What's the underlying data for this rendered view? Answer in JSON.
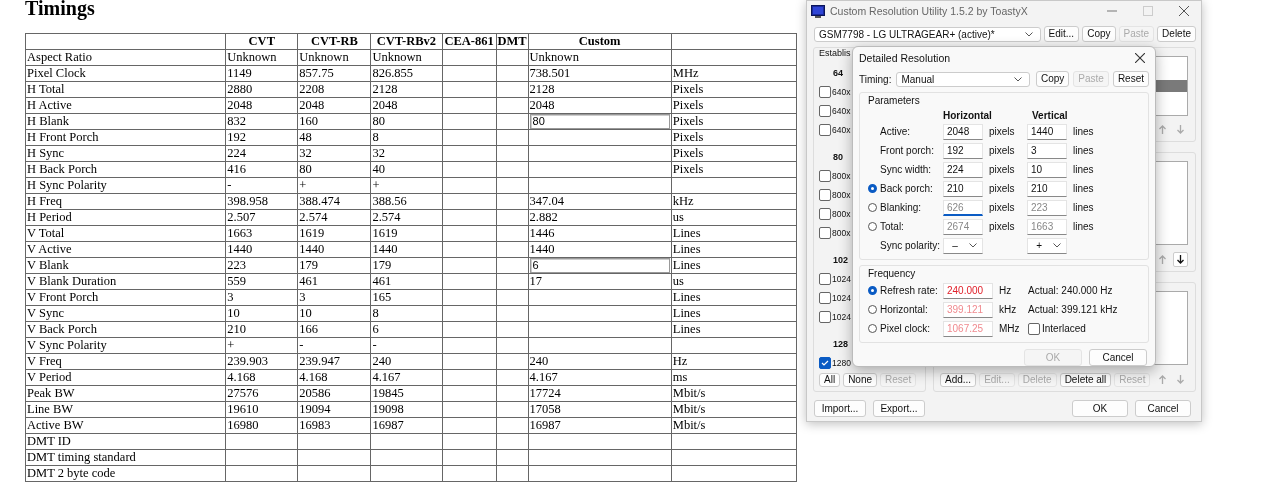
{
  "page": {
    "heading": "Timings",
    "table": {
      "columns": [
        "CVT",
        "CVT-RB",
        "CVT-RBv2",
        "CEA-861",
        "DMT",
        "Custom"
      ],
      "rows": [
        {
          "label": "Aspect Ratio",
          "cells": [
            "Unknown",
            "Unknown",
            "Unknown",
            null,
            null
          ],
          "custom": "Unknown",
          "custom_editable": false
        },
        {
          "label": "Pixel Clock",
          "cells": [
            "1149",
            "857.75",
            "826.855",
            null,
            null
          ],
          "custom": "738.501",
          "custom_editable": false,
          "unit": "MHz"
        },
        {
          "label": "H Total",
          "cells": [
            "2880",
            "2208",
            "2128",
            null,
            null
          ],
          "custom": "2128",
          "custom_editable": false,
          "unit": "Pixels"
        },
        {
          "label": "H Active",
          "cells": [
            "2048",
            "2048",
            "2048",
            null,
            null
          ],
          "custom": "2048",
          "custom_editable": false,
          "unit": "Pixels"
        },
        {
          "label": "H Blank",
          "cells": [
            "832",
            "160",
            "80",
            null,
            null
          ],
          "custom": "80",
          "custom_editable": true,
          "unit": "Pixels"
        },
        {
          "label": "H Front Porch",
          "cells": [
            "192",
            "48",
            "8",
            null,
            null
          ],
          "custom_editable": false,
          "unit": "Pixels"
        },
        {
          "label": "H Sync",
          "cells": [
            "224",
            "32",
            "32",
            null,
            null
          ],
          "custom_editable": false,
          "unit": "Pixels"
        },
        {
          "label": "H Back Porch",
          "cells": [
            "416",
            "80",
            "40",
            null,
            null
          ],
          "custom_editable": false,
          "unit": "Pixels"
        },
        {
          "label": "H Sync Polarity",
          "cells": [
            "-",
            "+",
            "+",
            null,
            null
          ],
          "custom_editable": false
        },
        {
          "label": "H Freq",
          "cells": [
            "398.958",
            "388.474",
            "388.56",
            null,
            null
          ],
          "custom": "347.04",
          "custom_editable": false,
          "unit": "kHz"
        },
        {
          "label": "H Period",
          "cells": [
            "2.507",
            "2.574",
            "2.574",
            null,
            null
          ],
          "custom": "2.882",
          "custom_editable": false,
          "unit": "us"
        },
        {
          "label": "V Total",
          "cells": [
            "1663",
            "1619",
            "1619",
            null,
            null
          ],
          "custom": "1446",
          "custom_editable": false,
          "unit": "Lines"
        },
        {
          "label": "V Active",
          "cells": [
            "1440",
            "1440",
            "1440",
            null,
            null
          ],
          "custom": "1440",
          "custom_editable": false,
          "unit": "Lines"
        },
        {
          "label": "V Blank",
          "cells": [
            "223",
            "179",
            "179",
            null,
            null
          ],
          "custom": "6",
          "custom_editable": true,
          "unit": "Lines"
        },
        {
          "label": "V Blank Duration",
          "cells": [
            "559",
            "461",
            "461",
            null,
            null
          ],
          "custom": "17",
          "custom_editable": false,
          "unit": "us"
        },
        {
          "label": "V Front Porch",
          "cells": [
            "3",
            "3",
            "165",
            null,
            null
          ],
          "custom_editable": false,
          "unit": "Lines"
        },
        {
          "label": "V Sync",
          "cells": [
            "10",
            "10",
            "8",
            null,
            null
          ],
          "custom_editable": false,
          "unit": "Lines"
        },
        {
          "label": "V Back Porch",
          "cells": [
            "210",
            "166",
            "6",
            null,
            null
          ],
          "custom_editable": false,
          "unit": "Lines"
        },
        {
          "label": "V Sync Polarity",
          "cells": [
            "+",
            "-",
            "-",
            null,
            null
          ],
          "custom_editable": false
        },
        {
          "label": "V Freq",
          "cells": [
            "239.903",
            "239.947",
            "240",
            null,
            null
          ],
          "custom": "240",
          "custom_editable": false,
          "unit": "Hz"
        },
        {
          "label": "V Period",
          "cells": [
            "4.168",
            "4.168",
            "4.167",
            null,
            null
          ],
          "custom": "4.167",
          "custom_editable": false,
          "unit": "ms"
        },
        {
          "label": "Peak BW",
          "cells": [
            "27576",
            "20586",
            "19845",
            null,
            null
          ],
          "custom": "17724",
          "custom_editable": false,
          "unit": "Mbit/s"
        },
        {
          "label": "Line BW",
          "cells": [
            "19610",
            "19094",
            "19098",
            null,
            null
          ],
          "custom": "17058",
          "custom_editable": false,
          "unit": "Mbit/s"
        },
        {
          "label": "Active BW",
          "cells": [
            "16980",
            "16983",
            "16987",
            null,
            null
          ],
          "custom": "16987",
          "custom_editable": false,
          "unit": "Mbit/s"
        },
        {
          "label": "DMT ID",
          "cells": [
            null,
            null,
            null,
            null,
            null
          ],
          "custom_editable": false
        },
        {
          "label": "DMT timing standard",
          "cells": [
            null,
            null,
            null,
            null,
            null
          ],
          "custom_editable": false
        },
        {
          "label": "DMT 2 byte code",
          "cells": [
            null,
            null,
            null,
            null,
            null
          ],
          "custom_editable": false
        }
      ]
    }
  },
  "cru_window": {
    "title": "Custom Resolution Utility 1.5.2 by ToastyX",
    "display": "GSM7798 - LG ULTRAGEAR+ (active)*",
    "top_buttons": [
      {
        "label": "Edit...",
        "disabled": false
      },
      {
        "label": "Copy",
        "disabled": false
      },
      {
        "label": "Paste",
        "disabled": true
      },
      {
        "label": "Delete",
        "disabled": false
      }
    ],
    "established": {
      "title": "Establis",
      "groups": [
        {
          "heading": "64",
          "items": [
            {
              "label": "640x",
              "checked": false
            },
            {
              "label": "640x",
              "checked": false
            },
            {
              "label": "640x",
              "checked": false
            }
          ]
        },
        {
          "heading": "80",
          "items": [
            {
              "label": "800x",
              "checked": false
            },
            {
              "label": "800x",
              "checked": false
            },
            {
              "label": "800x",
              "checked": false
            },
            {
              "label": "800x",
              "checked": false
            }
          ]
        },
        {
          "heading": "102",
          "items": [
            {
              "label": "1024",
              "checked": false
            },
            {
              "label": "1024",
              "checked": false
            },
            {
              "label": "1024",
              "checked": false
            }
          ]
        },
        {
          "heading": "128",
          "items": [
            {
              "label": "1280",
              "checked": true
            }
          ]
        }
      ],
      "buttons": [
        {
          "label": "All",
          "disabled": false
        },
        {
          "label": "None",
          "disabled": false
        },
        {
          "label": "Reset",
          "disabled": true
        }
      ]
    },
    "lists": [
      {
        "up_disabled": true,
        "down_disabled": true
      },
      {
        "up_disabled": true,
        "down_disabled": false
      },
      {
        "up_disabled": true,
        "down_disabled": true
      }
    ],
    "list_buttons": [
      {
        "label": "Add...",
        "disabled": false
      },
      {
        "label": "Edit...",
        "disabled": true
      },
      {
        "label": "Delete",
        "disabled": true
      },
      {
        "label": "Delete all",
        "disabled": false
      },
      {
        "label": "Reset",
        "disabled": true
      }
    ],
    "bottom_left_buttons": [
      "Import...",
      "Export..."
    ],
    "bottom_right_buttons": [
      "OK",
      "Cancel"
    ]
  },
  "dialog": {
    "title": "Detailed Resolution",
    "timing": {
      "label": "Timing:",
      "value": "Manual"
    },
    "timing_buttons": [
      {
        "label": "Copy",
        "disabled": false
      },
      {
        "label": "Paste",
        "disabled": true
      },
      {
        "label": "Reset",
        "disabled": false
      }
    ],
    "parameters": {
      "title": "Parameters",
      "headers": [
        "Horizontal",
        "Vertical"
      ],
      "rows": [
        {
          "kind": "plain",
          "label": "Active:",
          "h": "2048",
          "h_disabled": false,
          "h_unit": "pixels",
          "v": "1440",
          "v_disabled": false,
          "v_unit": "lines"
        },
        {
          "kind": "plain",
          "label": "Front porch:",
          "h": "192",
          "h_disabled": false,
          "h_unit": "pixels",
          "v": "3",
          "v_disabled": false,
          "v_unit": "lines"
        },
        {
          "kind": "plain",
          "label": "Sync width:",
          "h": "224",
          "h_disabled": false,
          "h_unit": "pixels",
          "v": "10",
          "v_disabled": false,
          "v_unit": "lines"
        },
        {
          "kind": "radio",
          "selected": true,
          "label": "Back porch:",
          "h": "210",
          "h_disabled": false,
          "h_unit": "pixels",
          "v": "210",
          "v_disabled": false,
          "v_unit": "lines"
        },
        {
          "kind": "radio",
          "selected": false,
          "label": "Blanking:",
          "h": "626",
          "h_disabled": true,
          "h_focused": true,
          "h_unit": "pixels",
          "v": "223",
          "v_disabled": true,
          "v_unit": "lines"
        },
        {
          "kind": "radio",
          "selected": false,
          "label": "Total:",
          "h": "2674",
          "h_disabled": true,
          "h_unit": "pixels",
          "v": "1663",
          "v_disabled": true,
          "v_unit": "lines"
        }
      ],
      "sync_polarity": {
        "label": "Sync polarity:",
        "h": "–",
        "v": "+"
      }
    },
    "frequency": {
      "title": "Frequency",
      "rows": [
        {
          "label": "Refresh rate:",
          "selected": true,
          "value": "240.000",
          "disabled": false,
          "unit": "Hz",
          "actual": "Actual: 240.000 Hz"
        },
        {
          "label": "Horizontal:",
          "selected": false,
          "value": "399.121",
          "disabled": true,
          "unit": "kHz",
          "actual": "Actual: 399.121 kHz"
        },
        {
          "label": "Pixel clock:",
          "selected": false,
          "value": "1067.25",
          "disabled": true,
          "unit": "MHz",
          "interlaced": {
            "label": "Interlaced",
            "checked": false
          }
        }
      ]
    },
    "buttons": [
      {
        "label": "OK",
        "disabled": true
      },
      {
        "label": "Cancel",
        "disabled": false
      }
    ]
  }
}
